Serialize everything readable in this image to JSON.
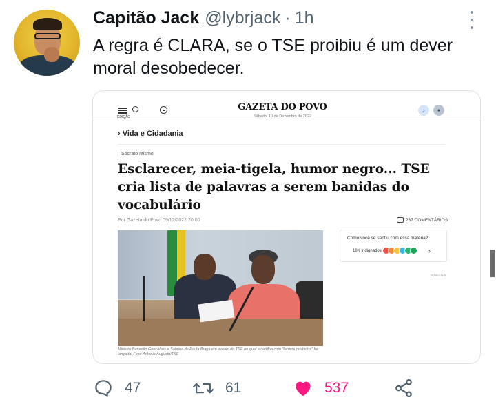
{
  "tweet": {
    "display_name": "Capitão Jack",
    "handle": "@lybrjack",
    "separator": "·",
    "time": "1h",
    "text": "A regra é CLARA, se o TSE proibiu é um dever moral desobedecer."
  },
  "card": {
    "brand": "GAZETA DO POVO",
    "brand_date": "Sábado, 10 de Dezembro de 2022",
    "menu_label": "EDIÇÃO",
    "section": "› Vida e Cidadania",
    "kicker": "Sócrato ntismo",
    "headline": "Esclarecer, meia-tigela, humor negro... TSE cria lista de palavras a serem banidas do vocabulário",
    "byline": "Por Gazeta do Povo 09/12/2022 20:00",
    "comments": "267 COMENTÁRIOS",
    "caption": "Ministro Benedito Gonçalves e Sabrina de Paula Braga em evento do TSE no qual a cartilha com \"termos proibidos\" foi lançada| Foto: Antonio Augusto/TSE",
    "feel_title": "Como você se sentiu com essa matéria?",
    "feel_count": "18K Indignados",
    "feel_arrow": "›",
    "publicidade": "Publicidade",
    "emoji_colors": [
      "#e8524a",
      "#f28a3c",
      "#f5c542",
      "#3fb6e8",
      "#2bb673",
      "#1fa35a"
    ]
  },
  "actions": {
    "replies": "47",
    "retweets": "61",
    "likes": "537"
  },
  "colors": {
    "like_accent": "#f91880",
    "muted": "#536471"
  }
}
